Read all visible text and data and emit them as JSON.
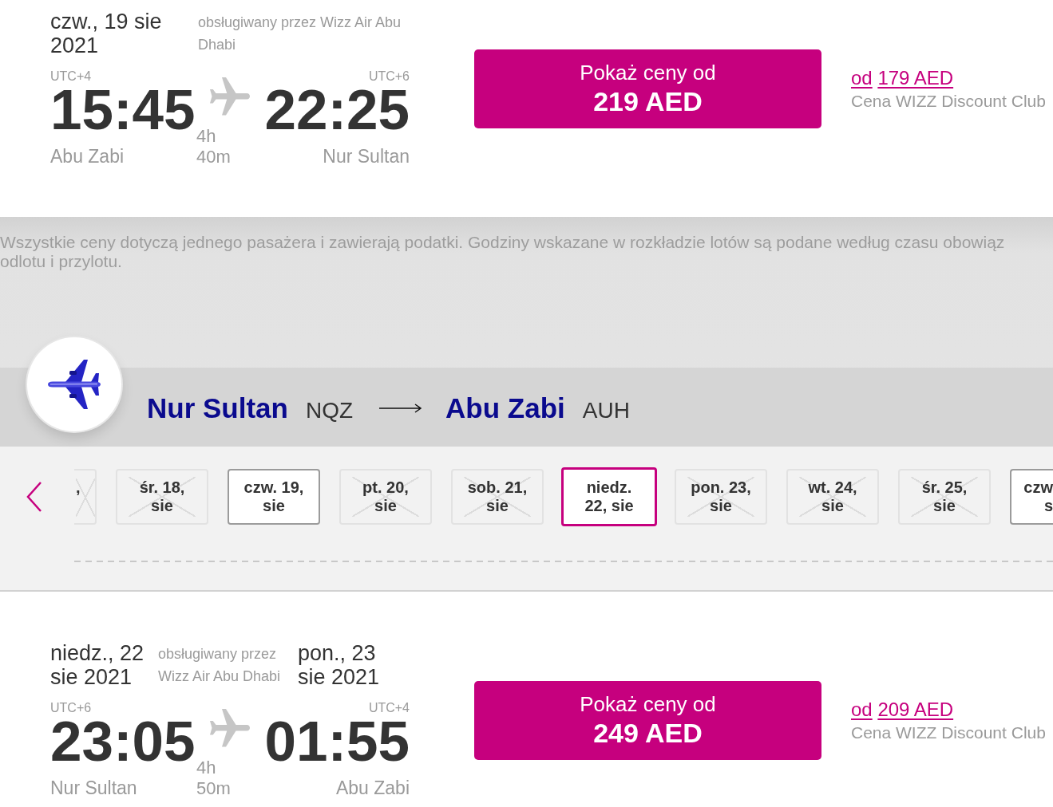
{
  "outbound_flight": {
    "departure_date": "czw., 19 sie 2021",
    "operator": "obsługiwany przez Wizz Air Abu Dhabi",
    "departure": {
      "timezone": "UTC+4",
      "time": "15:45",
      "city": "Abu Zabi"
    },
    "duration": "4h 40m",
    "arrival": {
      "timezone": "UTC+6",
      "time": "22:25",
      "city": "Nur Sultan"
    },
    "price_button": {
      "label": "Pokaż ceny od",
      "price": "219 AED"
    },
    "club_price": {
      "prefix": "od",
      "amount": "179 AED",
      "label": "Cena WIZZ Discount Club"
    }
  },
  "notice": {
    "lines": [
      "Wszystkie ceny dotyczą jednego pasażera i zawierają podatki. Godziny wskazane w rozkładzie lotów są podane według czasu obowiąz",
      "odlotu i przylotu."
    ]
  },
  "return_route": {
    "origin": {
      "city": "Nur Sultan",
      "code": "NQZ"
    },
    "destination": {
      "city": "Abu Zabi",
      "code": "AUH"
    }
  },
  "date_strip": {
    "dates": [
      {
        "label": ",",
        "kind": "leading",
        "available": false,
        "selected": false
      },
      {
        "label": "śr. 18, sie",
        "kind": "full",
        "available": false,
        "selected": false
      },
      {
        "label": "czw. 19, sie",
        "kind": "full",
        "available": true,
        "selected": false
      },
      {
        "label": "pt. 20, sie",
        "kind": "full",
        "available": false,
        "selected": false
      },
      {
        "label": "sob. 21, sie",
        "kind": "full",
        "available": false,
        "selected": false
      },
      {
        "label": "niedz. 22, sie",
        "kind": "full",
        "available": true,
        "selected": true
      },
      {
        "label": "pon. 23, sie",
        "kind": "full",
        "available": false,
        "selected": false
      },
      {
        "label": "wt. 24, sie",
        "kind": "full",
        "available": false,
        "selected": false
      },
      {
        "label": "śr. 25, sie",
        "kind": "full",
        "available": false,
        "selected": false
      },
      {
        "label": "czw s",
        "kind": "trailing",
        "available": true,
        "selected": false
      }
    ]
  },
  "return_flight": {
    "departure_date": "niedz., 22 sie 2021",
    "operator": "obsługiwany przez Wizz Air Abu Dhabi",
    "arrival_date": "pon., 23 sie 2021",
    "departure": {
      "timezone": "UTC+6",
      "time": "23:05",
      "city": "Nur Sultan"
    },
    "duration": "4h 50m",
    "arrival": {
      "timezone": "UTC+4",
      "time": "01:55",
      "city": "Abu Zabi"
    },
    "price_button": {
      "label": "Pokaż ceny od",
      "price": "249 AED"
    },
    "club_price": {
      "prefix": "od",
      "amount": "209 AED",
      "label": "Cena WIZZ Discount Club"
    }
  }
}
